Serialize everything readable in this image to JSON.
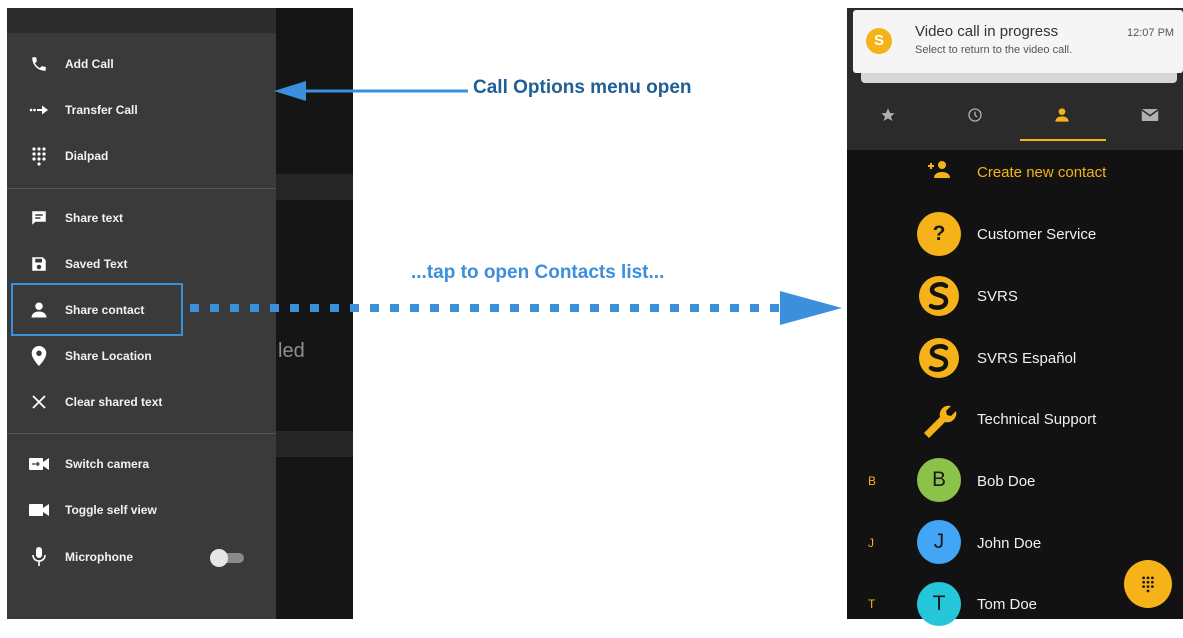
{
  "left_phone": {
    "menu_items": [
      {
        "label": "Add Call",
        "icon": "phone-icon"
      },
      {
        "label": "Transfer Call",
        "icon": "transfer-icon"
      },
      {
        "label": "Dialpad",
        "icon": "dialpad-icon"
      },
      {
        "label": "Share text",
        "icon": "message-icon"
      },
      {
        "label": "Saved Text",
        "icon": "save-icon"
      },
      {
        "label": "Share contact",
        "icon": "person-icon"
      },
      {
        "label": "Share Location",
        "icon": "location-icon"
      },
      {
        "label": "Clear shared text",
        "icon": "close-icon"
      },
      {
        "label": "Switch camera",
        "icon": "switch-camera-icon"
      },
      {
        "label": "Toggle self view",
        "icon": "video-camera-icon"
      },
      {
        "label": "Microphone",
        "icon": "microphone-icon"
      }
    ],
    "microphone_toggle": "off",
    "background_text": "led"
  },
  "annotations": {
    "menu_open": "Call Options menu open",
    "tap_contacts": "...tap to open Contacts list..."
  },
  "right_phone": {
    "notification": {
      "title": "Video call in progress",
      "subtitle": "Select to return to the video call.",
      "time": "12:07 PM",
      "icon": "svrs-logo-icon"
    },
    "tabs": [
      {
        "name": "favorites",
        "icon": "star-icon",
        "active": false
      },
      {
        "name": "recents",
        "icon": "clock-icon",
        "active": false
      },
      {
        "name": "contacts",
        "icon": "person-icon",
        "active": true
      },
      {
        "name": "messages",
        "icon": "mail-icon",
        "active": false
      }
    ],
    "create_contact_label": "Create new contact",
    "contacts": [
      {
        "name": "Customer Service",
        "letter": "",
        "avatar": "question-icon"
      },
      {
        "name": "SVRS",
        "letter": "",
        "avatar": "svrs-logo-icon"
      },
      {
        "name": "SVRS Español",
        "letter": "",
        "avatar": "svrs-logo-icon"
      },
      {
        "name": "Technical Support",
        "letter": "",
        "avatar": "wrench-icon"
      },
      {
        "name": "Bob Doe",
        "letter": "B",
        "avatar_text": "B",
        "avatar_color": "#8bc34a"
      },
      {
        "name": "John Doe",
        "letter": "J",
        "avatar_text": "J",
        "avatar_color": "#42a5f5"
      },
      {
        "name": "Tom Doe",
        "letter": "T",
        "avatar_text": "T",
        "avatar_color": "#26c6da"
      }
    ]
  },
  "colors": {
    "accent": "#f5b319",
    "annotation_dark": "#1f5f96",
    "annotation_light": "#3b8fdc"
  }
}
